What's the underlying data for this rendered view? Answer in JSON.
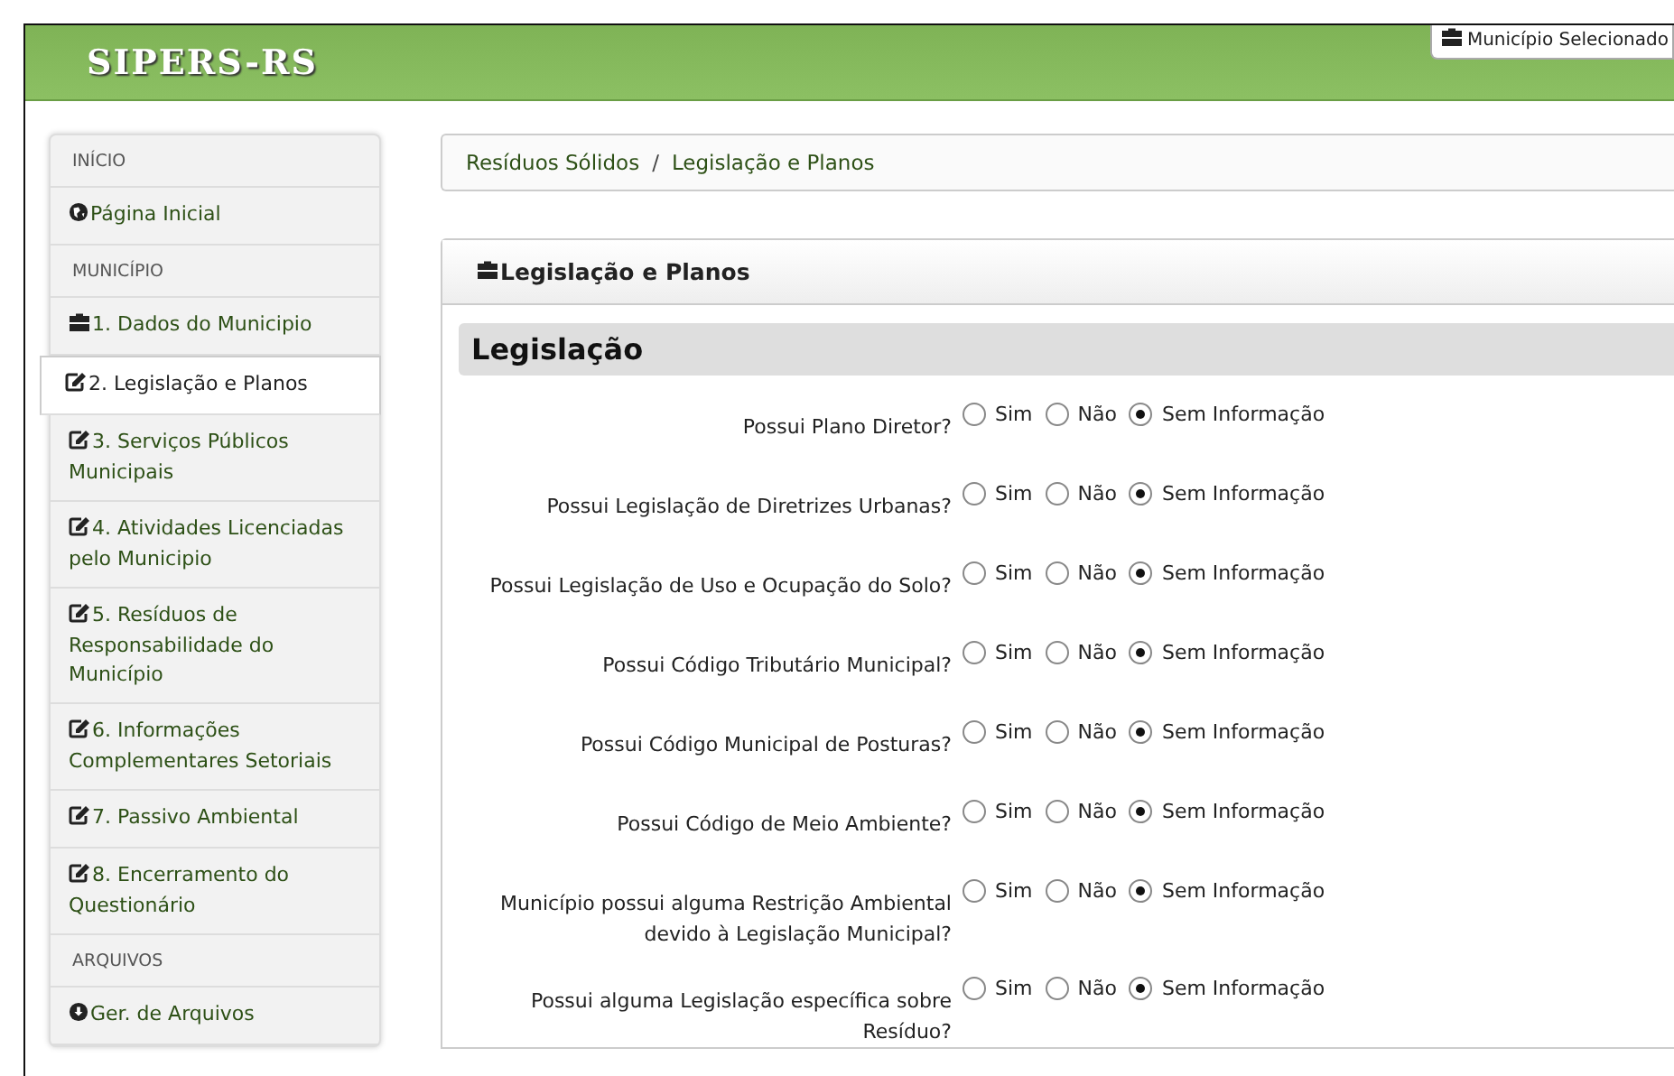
{
  "header": {
    "logo": "SIPERS-RS",
    "municipality_tab": "Município Selecionado"
  },
  "sidebar": {
    "items": [
      {
        "kind": "heading",
        "label": "INÍCIO"
      },
      {
        "kind": "home",
        "label": "Página Inicial",
        "selected": false
      },
      {
        "kind": "heading",
        "label": "MUNICÍPIO"
      },
      {
        "kind": "data",
        "label": "1. Dados do Municipio",
        "selected": false
      },
      {
        "kind": "step",
        "label": "2. Legislação e Planos",
        "selected": true
      },
      {
        "kind": "step",
        "label": "3. Serviços Públicos Municipais",
        "selected": false
      },
      {
        "kind": "step",
        "label": "4. Atividades Licenciadas pelo Municipio",
        "selected": false
      },
      {
        "kind": "step",
        "label": "5. Resíduos de Responsabilidade do Município",
        "selected": false
      },
      {
        "kind": "step",
        "label": "6. Informações Complementares Setoriais",
        "selected": false
      },
      {
        "kind": "step",
        "label": "7. Passivo Ambiental",
        "selected": false
      },
      {
        "kind": "step",
        "label": "8. Encerramento do Questionário",
        "selected": false
      },
      {
        "kind": "heading",
        "label": "ARQUIVOS"
      },
      {
        "kind": "files",
        "label": "Ger. de Arquivos",
        "selected": false
      }
    ]
  },
  "breadcrumb": {
    "items": [
      "Resíduos Sólidos",
      "Legislação e Planos"
    ],
    "separator": "/"
  },
  "panel": {
    "title": "Legislação e Planos",
    "section": "Legislação",
    "questions": [
      {
        "label": "Possui Plano Diretor?",
        "options": [
          {
            "label": "Sim",
            "selected": false
          },
          {
            "label": "Não",
            "selected": false
          },
          {
            "label": "Sem Informação",
            "selected": true
          }
        ]
      },
      {
        "label": "Possui Legislação de Diretrizes Urbanas?",
        "options": [
          {
            "label": "Sim",
            "selected": false
          },
          {
            "label": "Não",
            "selected": false
          },
          {
            "label": "Sem Informação",
            "selected": true
          }
        ]
      },
      {
        "label": "Possui Legislação de Uso e Ocupação do Solo?",
        "options": [
          {
            "label": "Sim",
            "selected": false
          },
          {
            "label": "Não",
            "selected": false
          },
          {
            "label": "Sem Informação",
            "selected": true
          }
        ]
      },
      {
        "label": "Possui Código Tributário Municipal?",
        "options": [
          {
            "label": "Sim",
            "selected": false
          },
          {
            "label": "Não",
            "selected": false
          },
          {
            "label": "Sem Informação",
            "selected": true
          }
        ]
      },
      {
        "label": "Possui Código Municipal de Posturas?",
        "options": [
          {
            "label": "Sim",
            "selected": false
          },
          {
            "label": "Não",
            "selected": false
          },
          {
            "label": "Sem Informação",
            "selected": true
          }
        ]
      },
      {
        "label": "Possui Código de Meio Ambiente?",
        "options": [
          {
            "label": "Sim",
            "selected": false
          },
          {
            "label": "Não",
            "selected": false
          },
          {
            "label": "Sem Informação",
            "selected": true
          }
        ]
      },
      {
        "label": "Município possui alguma Restrição Ambiental devido à Legislação Municipal?",
        "options": [
          {
            "label": "Sim",
            "selected": false
          },
          {
            "label": "Não",
            "selected": false
          },
          {
            "label": "Sem Informação",
            "selected": true
          }
        ]
      },
      {
        "label": "Possui alguma Legislação específica sobre Resíduo?",
        "options": [
          {
            "label": "Sim",
            "selected": false
          },
          {
            "label": "Não",
            "selected": false
          },
          {
            "label": "Sem Informação",
            "selected": true
          }
        ]
      }
    ]
  }
}
